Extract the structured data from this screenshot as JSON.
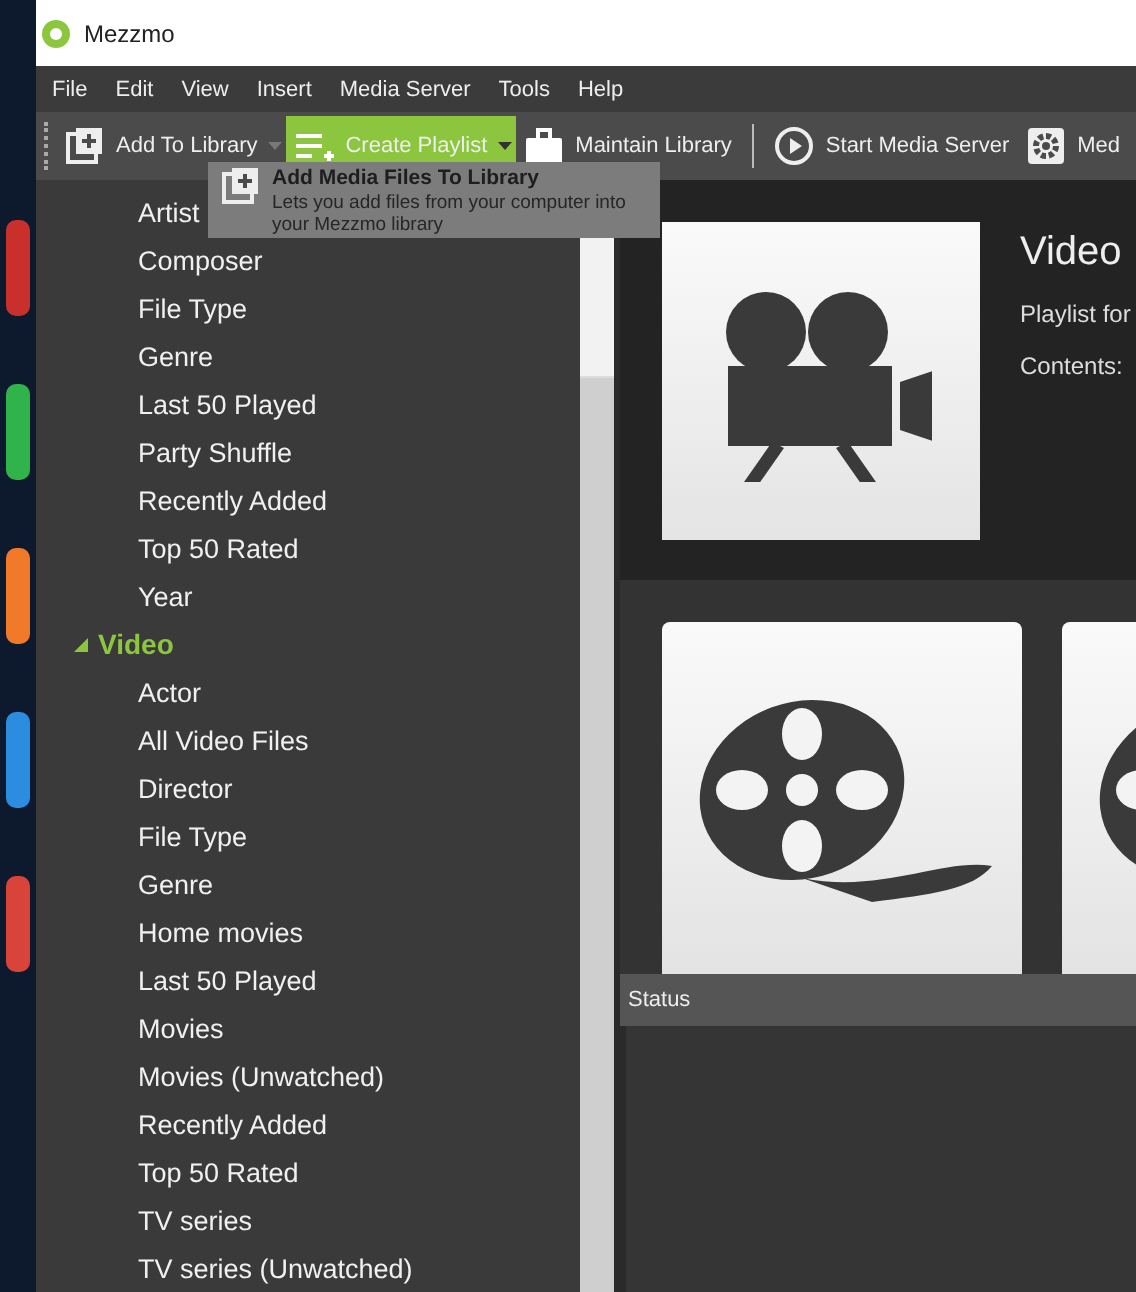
{
  "window": {
    "title": "Mezzmo"
  },
  "menu": [
    "File",
    "Edit",
    "View",
    "Insert",
    "Media Server",
    "Tools",
    "Help"
  ],
  "toolbar": [
    {
      "kind": "split",
      "label": "Add To Library",
      "hovered": false
    },
    {
      "kind": "split",
      "label": "Create Playlist",
      "hovered": true
    },
    {
      "kind": "button",
      "label": "Maintain Library",
      "hovered": false
    },
    {
      "kind": "separator"
    },
    {
      "kind": "button",
      "label": "Start Media Server",
      "hovered": false
    },
    {
      "kind": "button",
      "label": "Med",
      "hovered": false
    }
  ],
  "tooltip": {
    "title": "Add Media Files To Library",
    "text": "Lets you add files from your computer into your Mezzmo library"
  },
  "tree": [
    {
      "kind": "tail",
      "children": [
        {
          "label": "Artist"
        },
        {
          "label": "Composer"
        },
        {
          "label": "File Type"
        },
        {
          "label": "Genre"
        },
        {
          "label": "Last 50 Played"
        },
        {
          "label": "Party Shuffle"
        },
        {
          "label": "Recently Added"
        },
        {
          "label": "Top 50 Rated"
        },
        {
          "label": "Year"
        }
      ]
    },
    {
      "kind": "group",
      "label": "Video",
      "expanded": true,
      "children": [
        {
          "label": "Actor"
        },
        {
          "label": "All Video Files"
        },
        {
          "label": "Director"
        },
        {
          "label": "File Type"
        },
        {
          "label": "Genre"
        },
        {
          "label": "Home movies"
        },
        {
          "label": "Last 50 Played"
        },
        {
          "label": "Movies"
        },
        {
          "label": "Movies (Unwatched)"
        },
        {
          "label": "Recently Added"
        },
        {
          "label": "Top 50 Rated"
        },
        {
          "label": "TV series"
        },
        {
          "label": "TV series (Unwatched)"
        }
      ]
    }
  ],
  "details": {
    "title": "Video",
    "lines": [
      "Playlist for",
      "Contents:"
    ]
  },
  "tiles": [
    {
      "kind": "reel"
    },
    {
      "kind": "reel"
    }
  ],
  "status": {
    "title": "Status"
  }
}
